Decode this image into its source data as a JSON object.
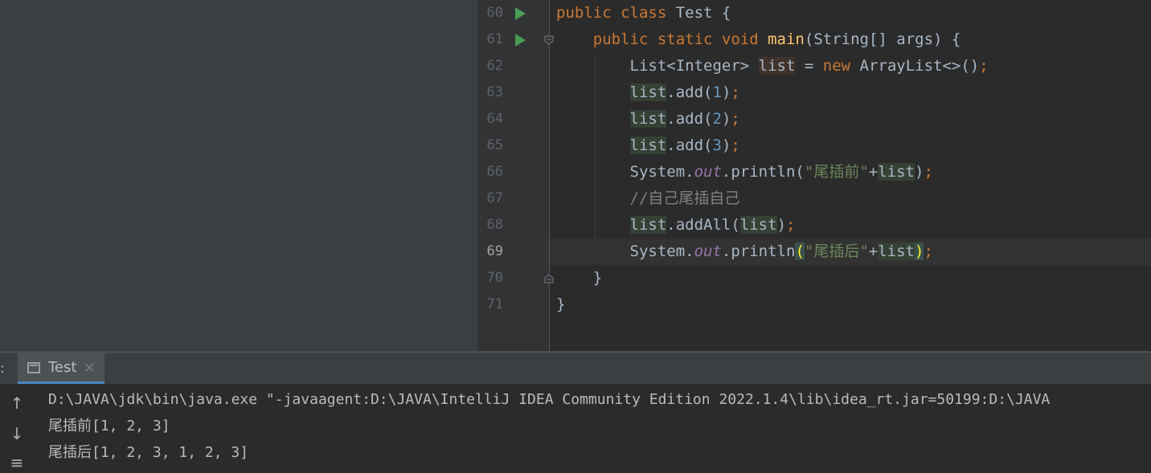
{
  "editor": {
    "line_numbers": [
      "60",
      "61",
      "62",
      "63",
      "64",
      "65",
      "66",
      "67",
      "68",
      "69",
      "70",
      "71"
    ],
    "lines": [
      {
        "tokens": [
          {
            "t": "public class ",
            "c": "kw"
          },
          {
            "t": "Test {",
            "c": ""
          }
        ]
      },
      {
        "tokens": [
          {
            "t": "    ",
            "c": ""
          },
          {
            "t": "public static void ",
            "c": "kw"
          },
          {
            "t": "main",
            "c": "fn"
          },
          {
            "t": "(String[] args) {",
            "c": ""
          }
        ]
      },
      {
        "tokens": [
          {
            "t": "        List<Integer> ",
            "c": ""
          },
          {
            "t": "list",
            "c": "hl-write"
          },
          {
            "t": " = ",
            "c": ""
          },
          {
            "t": "new ",
            "c": "kw"
          },
          {
            "t": "ArrayList<>()",
            "c": ""
          },
          {
            "t": ";",
            "c": "kw"
          }
        ]
      },
      {
        "tokens": [
          {
            "t": "        ",
            "c": ""
          },
          {
            "t": "list",
            "c": "hl"
          },
          {
            "t": ".add(",
            "c": ""
          },
          {
            "t": "1",
            "c": "num"
          },
          {
            "t": ")",
            "c": ""
          },
          {
            "t": ";",
            "c": "kw"
          }
        ]
      },
      {
        "tokens": [
          {
            "t": "        ",
            "c": ""
          },
          {
            "t": "list",
            "c": "hl"
          },
          {
            "t": ".add(",
            "c": ""
          },
          {
            "t": "2",
            "c": "num"
          },
          {
            "t": ")",
            "c": ""
          },
          {
            "t": ";",
            "c": "kw"
          }
        ]
      },
      {
        "tokens": [
          {
            "t": "        ",
            "c": ""
          },
          {
            "t": "list",
            "c": "hl"
          },
          {
            "t": ".add(",
            "c": ""
          },
          {
            "t": "3",
            "c": "num"
          },
          {
            "t": ")",
            "c": ""
          },
          {
            "t": ";",
            "c": "kw"
          }
        ]
      },
      {
        "tokens": [
          {
            "t": "        System.",
            "c": ""
          },
          {
            "t": "out",
            "c": "fld"
          },
          {
            "t": ".println(",
            "c": ""
          },
          {
            "t": "\"尾插前\"",
            "c": "str"
          },
          {
            "t": "+",
            "c": ""
          },
          {
            "t": "list",
            "c": "hl"
          },
          {
            "t": ")",
            "c": ""
          },
          {
            "t": ";",
            "c": "kw"
          }
        ]
      },
      {
        "tokens": [
          {
            "t": "        ",
            "c": ""
          },
          {
            "t": "//自己尾插自己",
            "c": "cmt"
          }
        ]
      },
      {
        "tokens": [
          {
            "t": "        ",
            "c": ""
          },
          {
            "t": "list",
            "c": "hl"
          },
          {
            "t": ".addAll(",
            "c": ""
          },
          {
            "t": "list",
            "c": "hl"
          },
          {
            "t": ")",
            "c": ""
          },
          {
            "t": ";",
            "c": "kw"
          }
        ]
      },
      {
        "tokens": [
          {
            "t": "        System.",
            "c": ""
          },
          {
            "t": "out",
            "c": "fld"
          },
          {
            "t": ".println",
            "c": ""
          },
          {
            "t": "(",
            "c": "brace-match"
          },
          {
            "t": "\"尾插后\"",
            "c": "str"
          },
          {
            "t": "+",
            "c": ""
          },
          {
            "t": "list",
            "c": "hl"
          },
          {
            "t": ")",
            "c": "brace-match"
          },
          {
            "t": ";",
            "c": "kw"
          }
        ]
      },
      {
        "tokens": [
          {
            "t": "    }",
            "c": ""
          }
        ]
      },
      {
        "tokens": [
          {
            "t": "}",
            "c": ""
          }
        ]
      }
    ],
    "current_line_index": 9
  },
  "toolwindow": {
    "prefix": ":",
    "tab_label": "Test",
    "tab_close": "×"
  },
  "console": {
    "lines": [
      "D:\\JAVA\\jdk\\bin\\java.exe \"-javaagent:D:\\JAVA\\IntelliJ IDEA Community Edition 2022.1.4\\lib\\idea_rt.jar=50199:D:\\JAVA",
      "尾插前[1, 2, 3]",
      "尾插后[1, 2, 3, 1, 2, 3]"
    ]
  },
  "icons": {
    "run_gutter": "run-triangle-icon",
    "fold": "fold-marker-icon",
    "up": "arrow-up-icon",
    "down": "arrow-down-icon",
    "wrap": "soft-wrap-icon"
  },
  "colors": {
    "keyword": "#cc7832",
    "function": "#ffc66d",
    "number": "#6897bb",
    "string": "#6a8759",
    "comment": "#808080",
    "field": "#9876aa"
  }
}
